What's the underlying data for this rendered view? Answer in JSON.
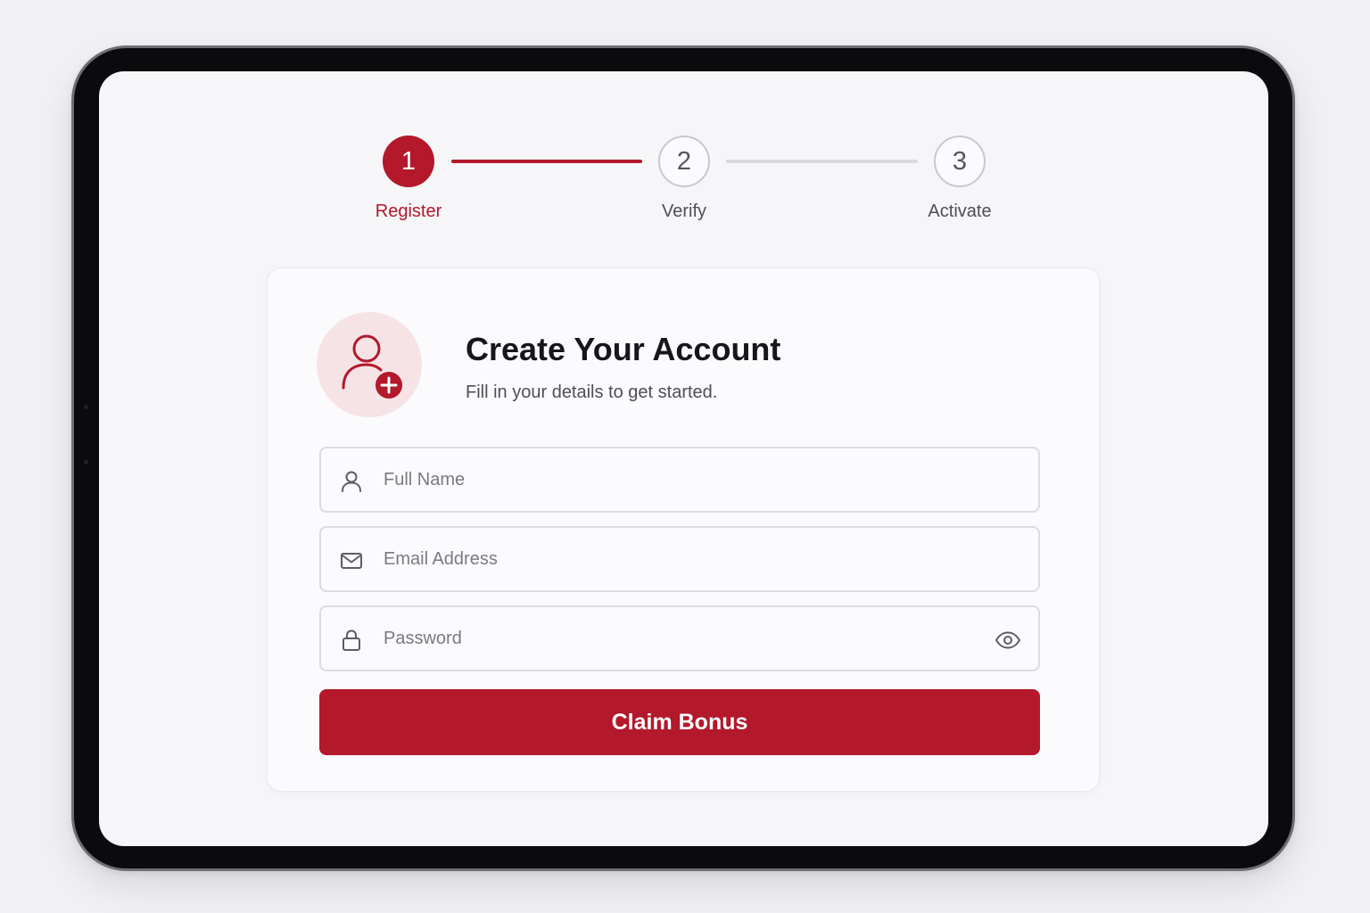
{
  "colors": {
    "accent": "#b3182b",
    "accent_soft": "#f6e3e6",
    "inactive_line": "#d9d8dc",
    "device_frame": "#0b0a0d",
    "screen_bg": "#f6f5f8",
    "card_bg": "#fbfafc"
  },
  "stepper": {
    "current_step": 1,
    "steps": [
      {
        "number": "1",
        "label": "Register",
        "state": "active"
      },
      {
        "number": "2",
        "label": "Verify",
        "state": "inactive"
      },
      {
        "number": "3",
        "label": "Activate",
        "state": "inactive"
      }
    ]
  },
  "card": {
    "avatar_icon": "user-plus-icon",
    "title": "Create Your Account",
    "subtitle": "Fill in your details to get started."
  },
  "form": {
    "full_name": {
      "icon": "user-icon",
      "placeholder": "Full Name",
      "value": ""
    },
    "email": {
      "icon": "mail-icon",
      "placeholder": "Email Address",
      "value": ""
    },
    "password": {
      "icon": "lock-icon",
      "placeholder": "Password",
      "value": "",
      "toggle_icon": "eye-icon"
    },
    "submit_label": "Claim Bonus"
  }
}
